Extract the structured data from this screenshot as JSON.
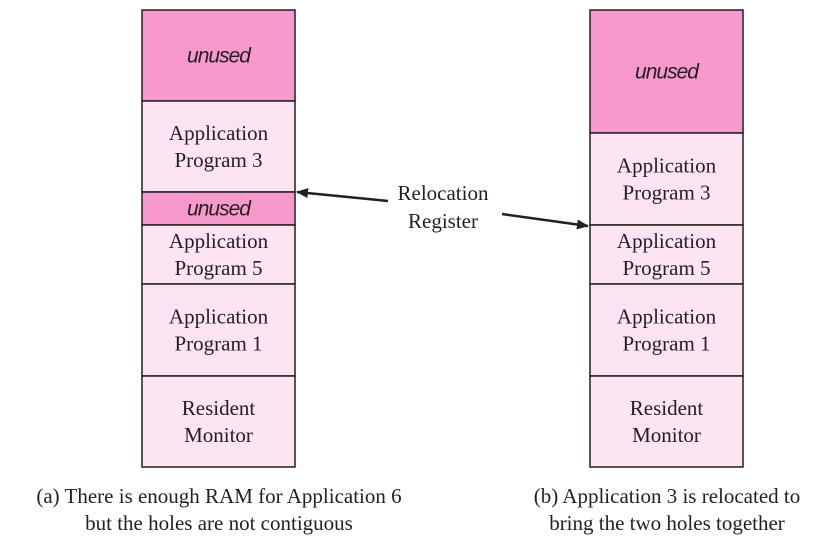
{
  "colors": {
    "unused": "#f799cc",
    "program": "#fde4f2",
    "stroke": "#231f20"
  },
  "left_column": [
    {
      "kind": "unused",
      "lines": [
        "unused"
      ]
    },
    {
      "kind": "program",
      "lines": [
        "Application",
        "Program 3"
      ]
    },
    {
      "kind": "unused",
      "lines": [
        "unused"
      ]
    },
    {
      "kind": "program",
      "lines": [
        "Application",
        "Program 5"
      ]
    },
    {
      "kind": "program",
      "lines": [
        "Application",
        "Program 1"
      ]
    },
    {
      "kind": "program",
      "lines": [
        "Resident",
        "Monitor"
      ]
    }
  ],
  "right_column": [
    {
      "kind": "unused",
      "lines": [
        "unused"
      ]
    },
    {
      "kind": "program",
      "lines": [
        "Application",
        "Program 3"
      ]
    },
    {
      "kind": "program",
      "lines": [
        "Application",
        "Program 5"
      ]
    },
    {
      "kind": "program",
      "lines": [
        "Application",
        "Program 1"
      ]
    },
    {
      "kind": "program",
      "lines": [
        "Resident",
        "Monitor"
      ]
    }
  ],
  "relocation_register": {
    "line1": "Relocation",
    "line2": "Register"
  },
  "captions": {
    "left_line1": "(a) There is enough RAM for Application 6",
    "left_line2": "but the holes are not contiguous",
    "right_line1": "(b) Application 3 is relocated to",
    "right_line2": "bring the two holes together"
  }
}
